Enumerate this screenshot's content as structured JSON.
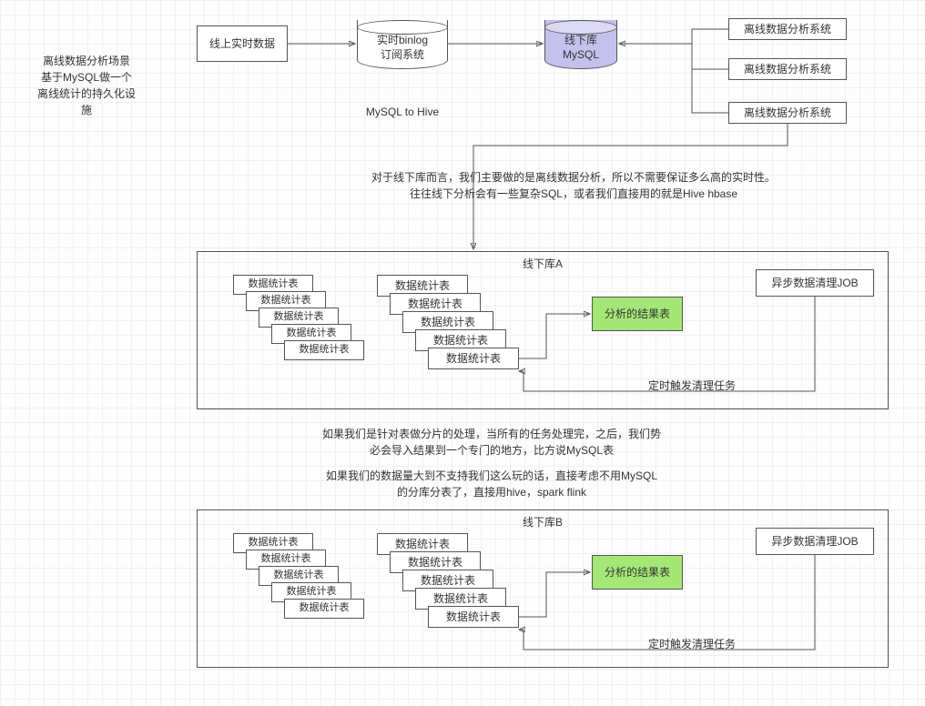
{
  "title_block": "离线数据分析场景\n基于MySQL做一个\n离线统计的持久化设\n施",
  "top": {
    "online_data": "线上实时数据",
    "binlog": "实时binlog\n订阅系统",
    "mysql_to_hive": "MySQL to Hive",
    "offline_db": "线下库\nMySQL",
    "analysis1": "离线数据分析系统",
    "analysis2": "离线数据分析系统",
    "analysis3": "离线数据分析系统"
  },
  "mid_text": "对于线下库而言，我们主要做的是离线数据分析，所以不需要保证多么高的实时性。\n往往线下分析会有一些复杂SQL，或者我们直接用的就是Hive hbase",
  "dbA": {
    "title": "线下库A",
    "stat_small": "数据统计表",
    "stat": "数据统计表",
    "result": "分析的结果表",
    "job": "异步数据清理JOB",
    "cleanup": "定时触发清理任务"
  },
  "between_text1": "如果我们是针对表做分片的处理，当所有的任务处理完，之后，我们势\n必会导入结果到一个专门的地方，比方说MySQL表",
  "between_text2": "如果我们的数据量大到不支持我们这么玩的话，直接考虑不用MySQL\n的分库分表了，直接用hive，spark flink",
  "dbB": {
    "title": "线下库B",
    "stat_small": "数据统计表",
    "stat": "数据统计表",
    "result": "分析的结果表",
    "job": "异步数据清理JOB",
    "cleanup": "定时触发清理任务"
  }
}
